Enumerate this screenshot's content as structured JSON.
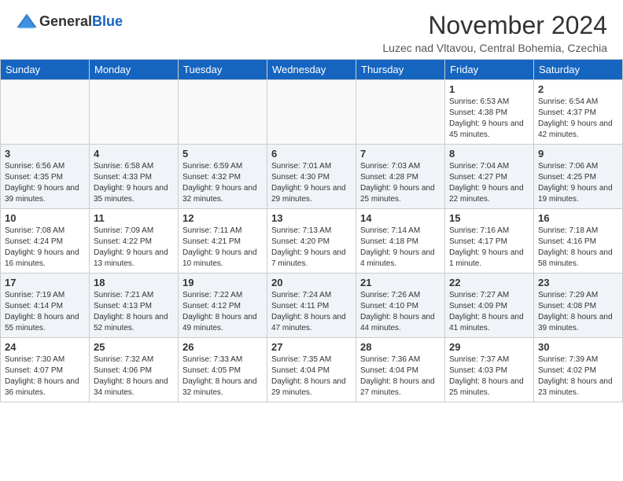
{
  "header": {
    "logo_general": "General",
    "logo_blue": "Blue",
    "month_title": "November 2024",
    "location": "Luzec nad Vltavou, Central Bohemia, Czechia"
  },
  "days_of_week": [
    "Sunday",
    "Monday",
    "Tuesday",
    "Wednesday",
    "Thursday",
    "Friday",
    "Saturday"
  ],
  "weeks": [
    [
      {
        "day": "",
        "info": ""
      },
      {
        "day": "",
        "info": ""
      },
      {
        "day": "",
        "info": ""
      },
      {
        "day": "",
        "info": ""
      },
      {
        "day": "",
        "info": ""
      },
      {
        "day": "1",
        "info": "Sunrise: 6:53 AM\nSunset: 4:38 PM\nDaylight: 9 hours and 45 minutes."
      },
      {
        "day": "2",
        "info": "Sunrise: 6:54 AM\nSunset: 4:37 PM\nDaylight: 9 hours and 42 minutes."
      }
    ],
    [
      {
        "day": "3",
        "info": "Sunrise: 6:56 AM\nSunset: 4:35 PM\nDaylight: 9 hours and 39 minutes."
      },
      {
        "day": "4",
        "info": "Sunrise: 6:58 AM\nSunset: 4:33 PM\nDaylight: 9 hours and 35 minutes."
      },
      {
        "day": "5",
        "info": "Sunrise: 6:59 AM\nSunset: 4:32 PM\nDaylight: 9 hours and 32 minutes."
      },
      {
        "day": "6",
        "info": "Sunrise: 7:01 AM\nSunset: 4:30 PM\nDaylight: 9 hours and 29 minutes."
      },
      {
        "day": "7",
        "info": "Sunrise: 7:03 AM\nSunset: 4:28 PM\nDaylight: 9 hours and 25 minutes."
      },
      {
        "day": "8",
        "info": "Sunrise: 7:04 AM\nSunset: 4:27 PM\nDaylight: 9 hours and 22 minutes."
      },
      {
        "day": "9",
        "info": "Sunrise: 7:06 AM\nSunset: 4:25 PM\nDaylight: 9 hours and 19 minutes."
      }
    ],
    [
      {
        "day": "10",
        "info": "Sunrise: 7:08 AM\nSunset: 4:24 PM\nDaylight: 9 hours and 16 minutes."
      },
      {
        "day": "11",
        "info": "Sunrise: 7:09 AM\nSunset: 4:22 PM\nDaylight: 9 hours and 13 minutes."
      },
      {
        "day": "12",
        "info": "Sunrise: 7:11 AM\nSunset: 4:21 PM\nDaylight: 9 hours and 10 minutes."
      },
      {
        "day": "13",
        "info": "Sunrise: 7:13 AM\nSunset: 4:20 PM\nDaylight: 9 hours and 7 minutes."
      },
      {
        "day": "14",
        "info": "Sunrise: 7:14 AM\nSunset: 4:18 PM\nDaylight: 9 hours and 4 minutes."
      },
      {
        "day": "15",
        "info": "Sunrise: 7:16 AM\nSunset: 4:17 PM\nDaylight: 9 hours and 1 minute."
      },
      {
        "day": "16",
        "info": "Sunrise: 7:18 AM\nSunset: 4:16 PM\nDaylight: 8 hours and 58 minutes."
      }
    ],
    [
      {
        "day": "17",
        "info": "Sunrise: 7:19 AM\nSunset: 4:14 PM\nDaylight: 8 hours and 55 minutes."
      },
      {
        "day": "18",
        "info": "Sunrise: 7:21 AM\nSunset: 4:13 PM\nDaylight: 8 hours and 52 minutes."
      },
      {
        "day": "19",
        "info": "Sunrise: 7:22 AM\nSunset: 4:12 PM\nDaylight: 8 hours and 49 minutes."
      },
      {
        "day": "20",
        "info": "Sunrise: 7:24 AM\nSunset: 4:11 PM\nDaylight: 8 hours and 47 minutes."
      },
      {
        "day": "21",
        "info": "Sunrise: 7:26 AM\nSunset: 4:10 PM\nDaylight: 8 hours and 44 minutes."
      },
      {
        "day": "22",
        "info": "Sunrise: 7:27 AM\nSunset: 4:09 PM\nDaylight: 8 hours and 41 minutes."
      },
      {
        "day": "23",
        "info": "Sunrise: 7:29 AM\nSunset: 4:08 PM\nDaylight: 8 hours and 39 minutes."
      }
    ],
    [
      {
        "day": "24",
        "info": "Sunrise: 7:30 AM\nSunset: 4:07 PM\nDaylight: 8 hours and 36 minutes."
      },
      {
        "day": "25",
        "info": "Sunrise: 7:32 AM\nSunset: 4:06 PM\nDaylight: 8 hours and 34 minutes."
      },
      {
        "day": "26",
        "info": "Sunrise: 7:33 AM\nSunset: 4:05 PM\nDaylight: 8 hours and 32 minutes."
      },
      {
        "day": "27",
        "info": "Sunrise: 7:35 AM\nSunset: 4:04 PM\nDaylight: 8 hours and 29 minutes."
      },
      {
        "day": "28",
        "info": "Sunrise: 7:36 AM\nSunset: 4:04 PM\nDaylight: 8 hours and 27 minutes."
      },
      {
        "day": "29",
        "info": "Sunrise: 7:37 AM\nSunset: 4:03 PM\nDaylight: 8 hours and 25 minutes."
      },
      {
        "day": "30",
        "info": "Sunrise: 7:39 AM\nSunset: 4:02 PM\nDaylight: 8 hours and 23 minutes."
      }
    ]
  ]
}
